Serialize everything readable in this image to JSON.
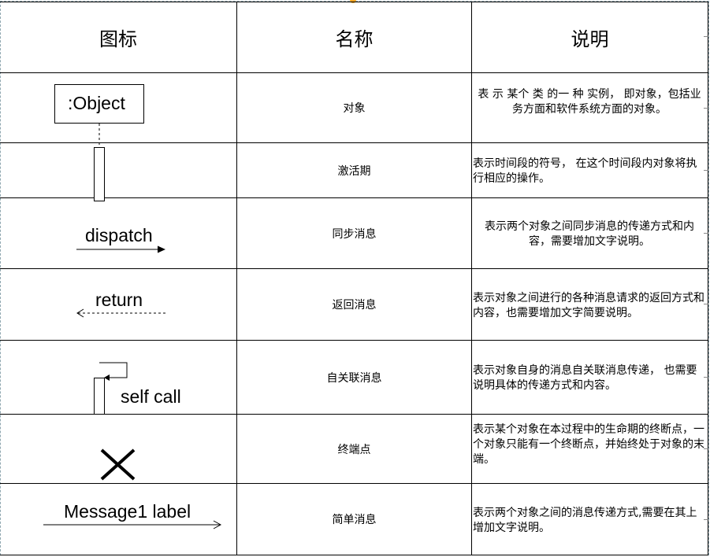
{
  "headers": {
    "icon": "图标",
    "name": "名称",
    "description": "说明"
  },
  "rows": [
    {
      "key": "object",
      "icon_label": ":Object",
      "icon": "object-box-icon",
      "name": "对象",
      "description": "表 示 某个 类 的一 种 实例， 即对象，包括业务方面和软件系统方面的对象。"
    },
    {
      "key": "activation",
      "icon_label": "",
      "icon": "activation-bar-icon",
      "name": "激活期",
      "description": "表示时间段的符号， 在这个时间段内对象将执行相应的操作。"
    },
    {
      "key": "sync-message",
      "icon_label": "dispatch",
      "icon": "solid-arrow-icon",
      "name": "同步消息",
      "description": "表示两个对象之间同步消息的传递方式和内容，需要增加文字说明。"
    },
    {
      "key": "return-message",
      "icon_label": "return",
      "icon": "dashed-arrow-icon",
      "name": "返回消息",
      "description": "表示对象之间进行的各种消息请求的返回方式和内容，也需要增加文字简要说明。"
    },
    {
      "key": "self-message",
      "icon_label": "self call",
      "icon": "self-call-icon",
      "name": "自关联消息",
      "description": "表示对象自身的消息自关联消息传递， 也需要说明具体的传递方式和内容。"
    },
    {
      "key": "terminator",
      "icon_label": "",
      "icon": "x-terminator-icon",
      "name": "终端点",
      "description": "表示某个对象在本过程中的生命期的终断点，一个对象只能有一个终断点，并始终处于对象的末端。"
    },
    {
      "key": "simple-message",
      "icon_label": "Message1 label",
      "icon": "open-arrow-icon",
      "name": "简单消息",
      "description": "表示两个对象之间的消息传递方式,需要在其上增加文字说明。"
    }
  ],
  "colors": {
    "border": "#000000",
    "selection_dash": "#8fa7b0",
    "handle": "#f5a623"
  }
}
